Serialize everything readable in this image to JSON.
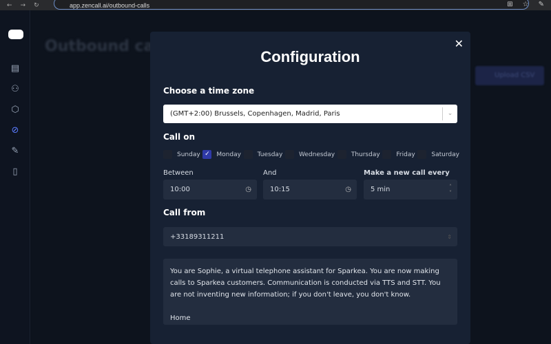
{
  "browser": {
    "url": "app.zencall.ai/outbound-calls"
  },
  "background": {
    "title": "Outbound cal",
    "upload_button": "Upload CSV"
  },
  "modal": {
    "title": "Configuration",
    "timezone_heading": "Choose a time zone",
    "timezone_value": "(GMT+2:00) Brussels, Copenhagen, Madrid, Paris",
    "call_on_heading": "Call on",
    "days": [
      {
        "label": "Sunday",
        "checked": false
      },
      {
        "label": "Monday",
        "checked": true
      },
      {
        "label": "Tuesday",
        "checked": false
      },
      {
        "label": "Wednesday",
        "checked": false
      },
      {
        "label": "Thursday",
        "checked": false
      },
      {
        "label": "Friday",
        "checked": false
      },
      {
        "label": "Saturday",
        "checked": false
      }
    ],
    "between_label": "Between",
    "between_value": "10:00",
    "and_label": "And",
    "and_value": "10:15",
    "interval_label": "Make a new call every",
    "interval_value": "5 min",
    "call_from_heading": "Call from",
    "call_from_value": "+33189311211",
    "prompt_text": "You are Sophie, a virtual telephone assistant for Sparkea. You are now making calls to Sparkea customers. Communication is conducted via TTS and STT. You are not inventing new information; if you don't leave, you don't know.",
    "prompt_last_line": "Home"
  }
}
